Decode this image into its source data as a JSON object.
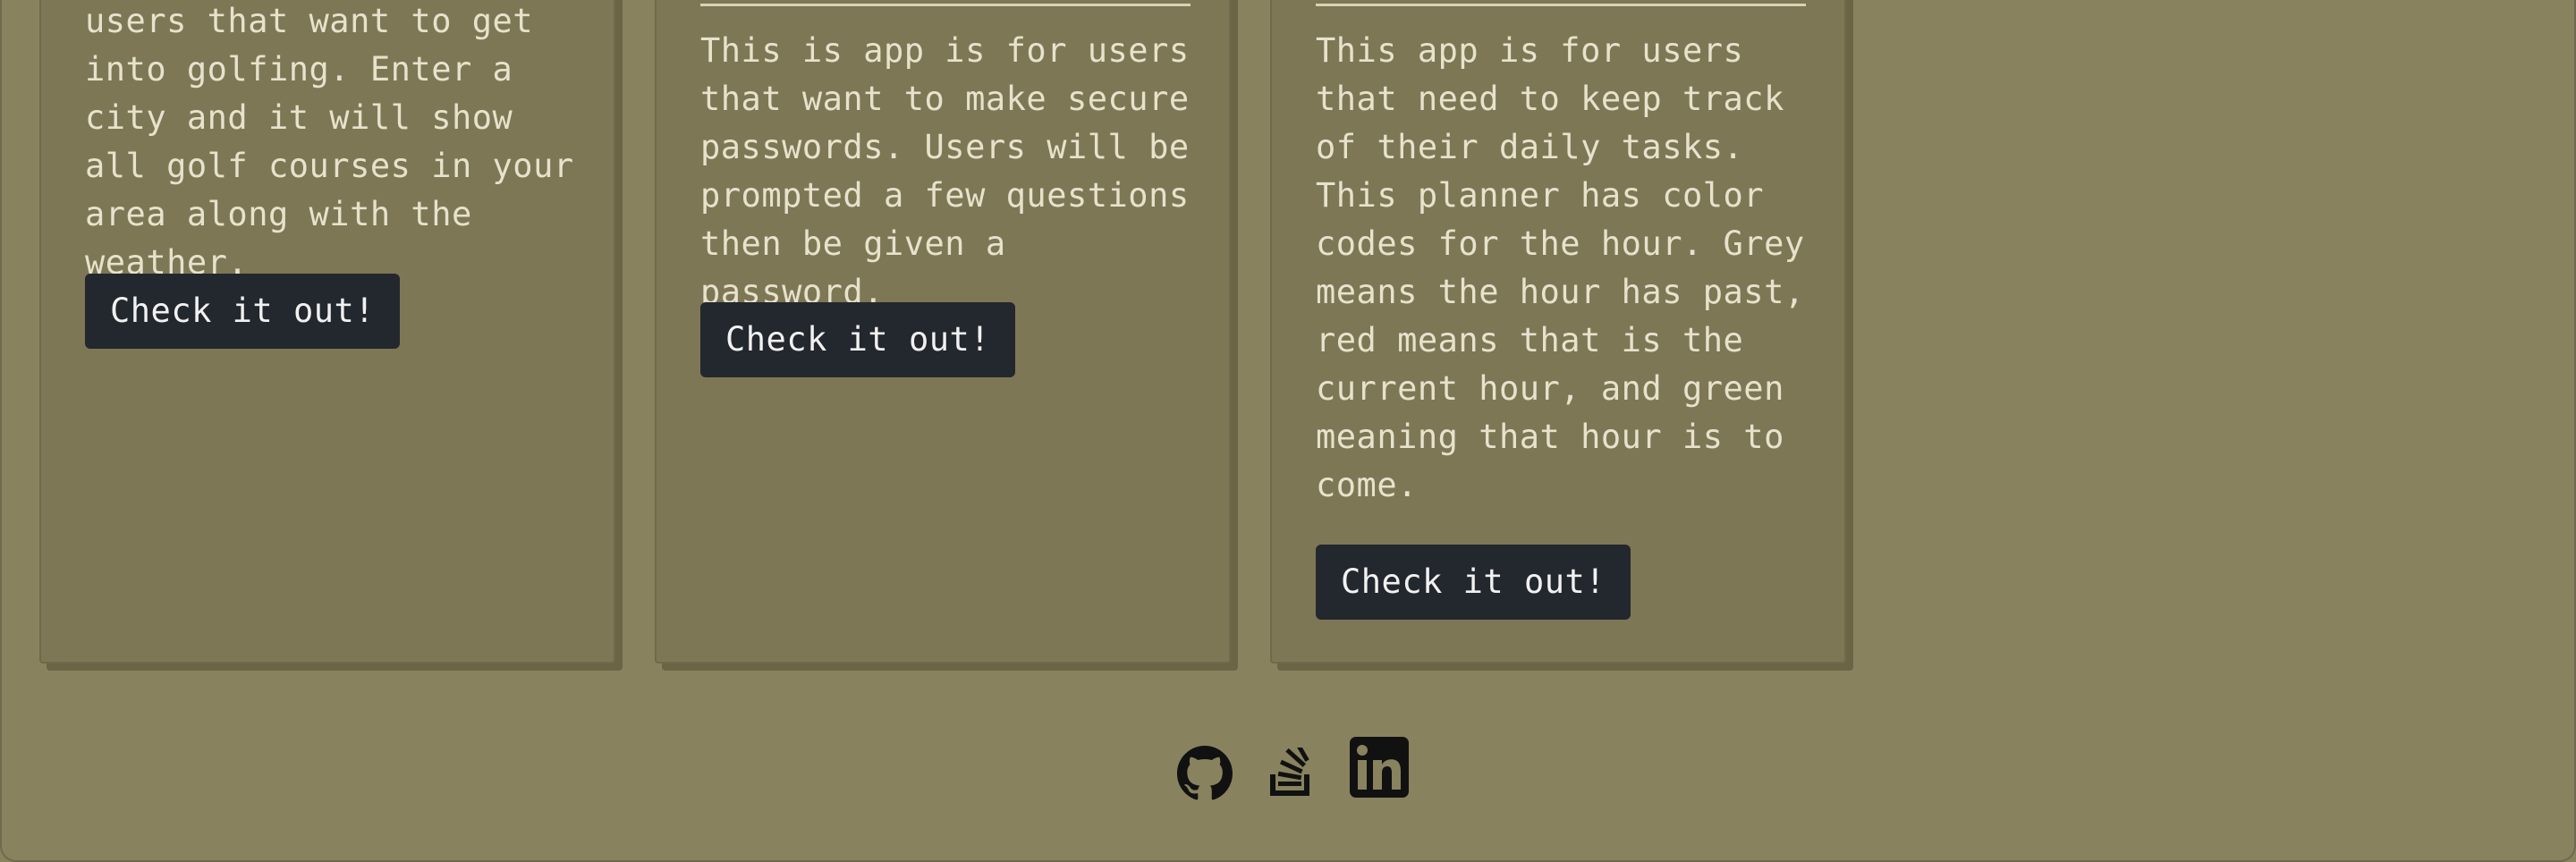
{
  "projects": [
    {
      "description": "users that want to get into golfing. Enter a city and it will show all golf courses in your area along with the weather.",
      "button_label": "Check it out!"
    },
    {
      "description": "This is app is for users that want to make secure passwords. Users will be prompted a few questions then be given a password.",
      "button_label": "Check it out!"
    },
    {
      "description": "This app is for users that need to keep track of their daily tasks. This planner has color codes for the hour. Grey means the hour has past, red means that is the current hour, and green meaning that hour is to come.",
      "button_label": "Check it out!"
    }
  ],
  "footer": {
    "icons": [
      "github-icon",
      "stack-overflow-icon",
      "linkedin-icon"
    ]
  },
  "colors": {
    "page_background": "#88825f",
    "card_background": "#7e7755",
    "card_text": "#e6e2cc",
    "button_background": "#23272e",
    "button_text": "#f1f1f1",
    "icon": "#111111"
  }
}
